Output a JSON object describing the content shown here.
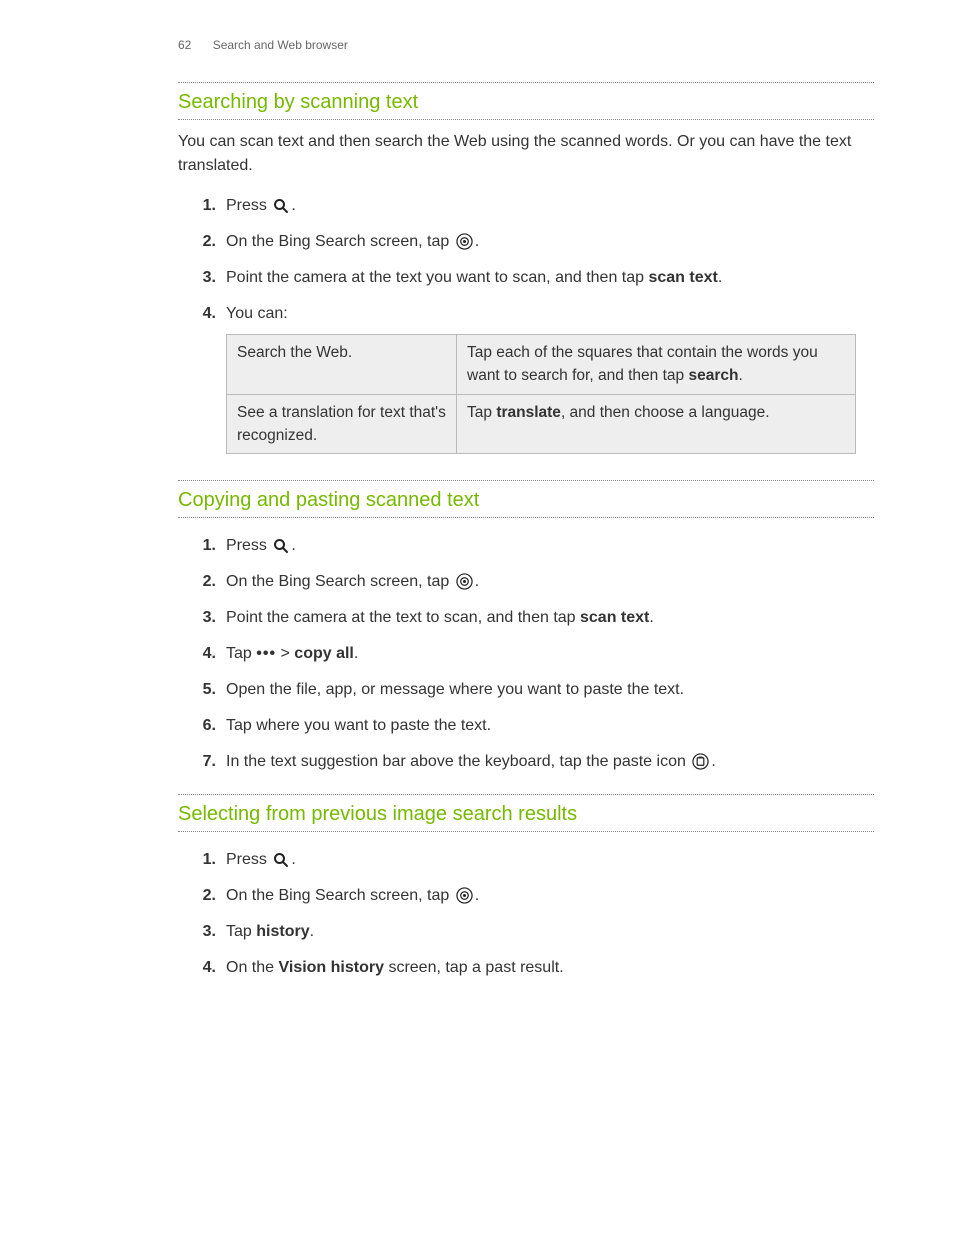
{
  "header": {
    "page_number": "62",
    "chapter": "Search and Web browser"
  },
  "sec1": {
    "title": "Searching by scanning text",
    "intro": "You can scan text and then search the Web using the scanned words. Or you can have the text translated.",
    "step1": "Press ",
    "step2a": "On the Bing Search screen, tap ",
    "step3a": "Point the camera at the text you want to scan, and then tap ",
    "step3b": "scan text",
    "step4": "You can:",
    "table": {
      "r1c1": "Search the Web.",
      "r1c2a": "Tap each of the squares that contain the words you want to search for, and then tap ",
      "r1c2b": "search",
      "r2c1": "See a translation for text that's recognized.",
      "r2c2a": "Tap ",
      "r2c2b": "translate",
      "r2c2c": ", and then choose a language."
    }
  },
  "sec2": {
    "title": "Copying and pasting scanned text",
    "step1": "Press ",
    "step2a": "On the Bing Search screen, tap ",
    "step3a": "Point the camera at the text to scan, and then tap ",
    "step3b": "scan text",
    "step4a": "Tap ",
    "step4b": " > ",
    "step4c": "copy all",
    "step5": "Open the file, app, or message where you want to paste the text.",
    "step6": "Tap where you want to paste the text.",
    "step7a": "In the text suggestion bar above the keyboard, tap the paste icon "
  },
  "sec3": {
    "title": "Selecting from previous image search results",
    "step1": "Press ",
    "step2a": "On the Bing Search screen, tap ",
    "step3a": "Tap ",
    "step3b": "history",
    "step4a": "On the ",
    "step4b": "Vision history",
    "step4c": " screen, tap a past result."
  }
}
